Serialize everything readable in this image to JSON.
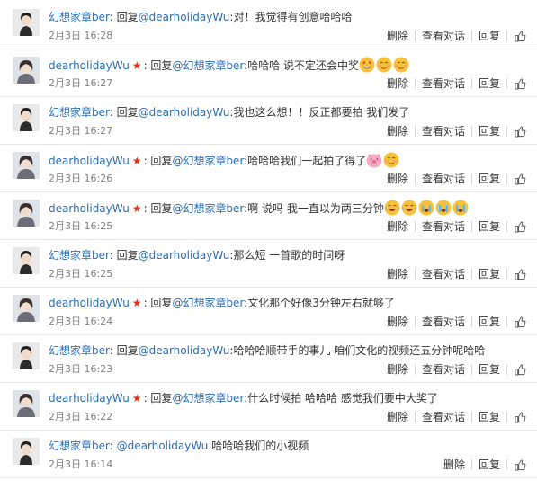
{
  "comments": [
    {
      "user": "幻想家章ber",
      "user_star": false,
      "reply_prefix": ": 回复",
      "mention": "@dearholidayWu",
      "text": ":对！我觉得有创意哈哈哈",
      "emojis": [],
      "time": "2月3日 16:28",
      "actions": [
        "删除",
        "查看对话",
        "回复"
      ]
    },
    {
      "user": "dearholidayWu",
      "user_star": true,
      "reply_prefix": ": 回复",
      "mention": "@幻想家章ber",
      "text": ":哈哈哈 说不定还会中奖",
      "emojis": [
        "heart-eyes-emoji",
        "smile-emoji",
        "smile-emoji"
      ],
      "time": "2月3日 16:27",
      "actions": [
        "删除",
        "查看对话",
        "回复"
      ]
    },
    {
      "user": "幻想家章ber",
      "user_star": false,
      "reply_prefix": ": 回复",
      "mention": "@dearholidayWu",
      "text": ":我也这么想！！反正都要拍 我们发了",
      "emojis": [],
      "time": "2月3日 16:27",
      "actions": [
        "删除",
        "查看对话",
        "回复"
      ]
    },
    {
      "user": "dearholidayWu",
      "user_star": true,
      "reply_prefix": ": 回复",
      "mention": "@幻想家章ber",
      "text": ":哈哈哈我们一起拍了得了",
      "emojis": [
        "pig-emoji",
        "smile-emoji"
      ],
      "time": "2月3日 16:26",
      "actions": [
        "删除",
        "查看对话",
        "回复"
      ]
    },
    {
      "user": "dearholidayWu",
      "user_star": true,
      "reply_prefix": ": 回复",
      "mention": "@幻想家章ber",
      "text": ":啊 说吗 我一直以为两三分钟",
      "emojis": [
        "laugh-cry-emoji",
        "laugh-cry-emoji",
        "crying-emoji",
        "crying-emoji",
        "crying-emoji"
      ],
      "time": "2月3日 16:25",
      "actions": [
        "删除",
        "查看对话",
        "回复"
      ]
    },
    {
      "user": "幻想家章ber",
      "user_star": false,
      "reply_prefix": ": 回复",
      "mention": "@dearholidayWu",
      "text": ":那么短 一首歌的时间呀",
      "emojis": [],
      "time": "2月3日 16:25",
      "actions": [
        "删除",
        "查看对话",
        "回复"
      ]
    },
    {
      "user": "dearholidayWu",
      "user_star": true,
      "reply_prefix": ": 回复",
      "mention": "@幻想家章ber",
      "text": ":文化那个好像3分钟左右就够了",
      "emojis": [],
      "time": "2月3日 16:24",
      "actions": [
        "删除",
        "查看对话",
        "回复"
      ]
    },
    {
      "user": "幻想家章ber",
      "user_star": false,
      "reply_prefix": ": 回复",
      "mention": "@dearholidayWu",
      "text": ":哈哈哈顺带手的事儿 咱们文化的视频还五分钟呢哈哈",
      "emojis": [],
      "time": "2月3日 16:23",
      "actions": [
        "删除",
        "查看对话",
        "回复"
      ]
    },
    {
      "user": "dearholidayWu",
      "user_star": true,
      "reply_prefix": ": 回复",
      "mention": "@幻想家章ber",
      "text": ":什么时候拍 哈哈哈 感觉我们要中大奖了",
      "emojis": [],
      "time": "2月3日 16:22",
      "actions": [
        "删除",
        "查看对话",
        "回复"
      ]
    },
    {
      "user": "幻想家章ber",
      "user_star": false,
      "reply_prefix": ": ",
      "mention": "@dearholidayWu",
      "text": " 哈哈哈我们的小视频",
      "emojis": [],
      "time": "2月3日 16:14",
      "actions": [
        "删除",
        "回复"
      ]
    }
  ],
  "colors": {
    "link": "#2a6db8",
    "star": "#e0301e",
    "meta": "#808080",
    "divider": "#e6e6e6"
  }
}
